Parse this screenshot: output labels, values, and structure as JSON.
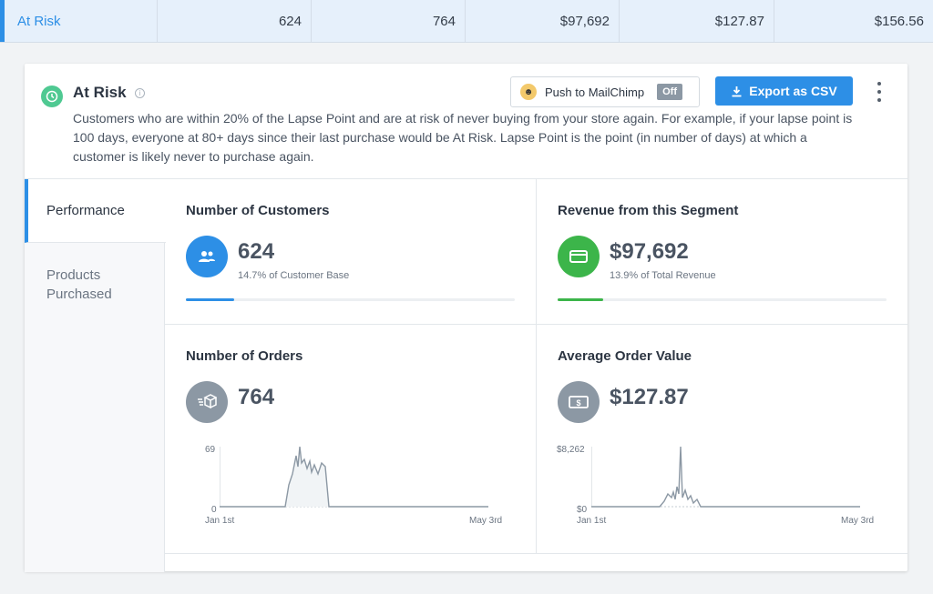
{
  "top_row": {
    "name": "At Risk",
    "values": [
      "624",
      "764",
      "$97,692",
      "$127.87",
      "$156.56"
    ]
  },
  "segment": {
    "title": "At Risk",
    "description": "Customers who are within 20% of the Lapse Point and are at risk of never buying from your store again. For example, if your lapse point is 100 days, everyone at 80+ days since their last purchase would be At Risk. Lapse Point is the point (in number of days) at which a customer is likely never to purchase again.",
    "mailchimp_label": "Push to MailChimp",
    "mailchimp_toggle": "Off",
    "export_label": "Export as CSV"
  },
  "tabs": {
    "performance": "Performance",
    "products": "Products Purchased"
  },
  "metrics": {
    "customers": {
      "title": "Number of Customers",
      "value": "624",
      "sub": "14.7% of Customer Base",
      "progress": 0.147,
      "color": "#2d8fe6"
    },
    "revenue": {
      "title": "Revenue from this Segment",
      "value": "$97,692",
      "sub": "13.9% of Total Revenue",
      "progress": 0.139,
      "color": "#3cb54a"
    },
    "orders": {
      "title": "Number of Orders",
      "value": "764",
      "y_max": "69",
      "y_min": "0",
      "x_start": "Jan 1st",
      "x_end": "May 3rd"
    },
    "aov": {
      "title": "Average Order Value",
      "value": "$127.87",
      "y_max": "$8,262",
      "y_min": "$0",
      "x_start": "Jan 1st",
      "x_end": "May 3rd"
    }
  },
  "colors": {
    "accent": "#2d8fe6",
    "green": "#3cb54a",
    "gray_icon": "#8c98a4",
    "status_icon": "#4fc992"
  },
  "icons": {
    "segment": "clock-icon",
    "customers": "users-icon",
    "revenue": "credit-card-icon",
    "orders": "box-icon",
    "aov": "money-icon"
  }
}
